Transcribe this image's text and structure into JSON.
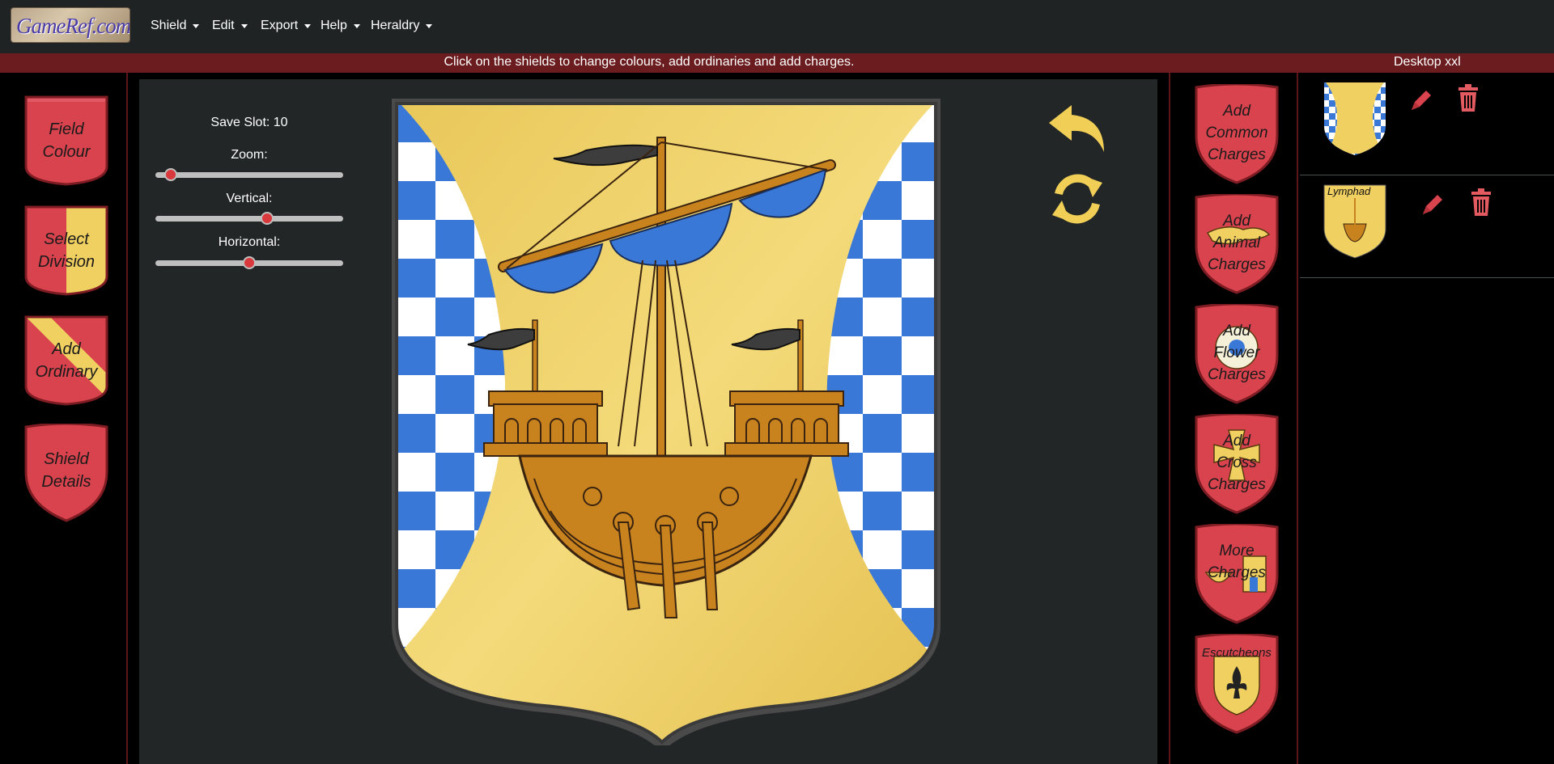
{
  "nav": {
    "logo_text": "GameRef.com",
    "menus": [
      "Shield",
      "Edit",
      "Export",
      "Help",
      "Heraldry"
    ]
  },
  "banner": {
    "message": "Click on the shields to change colours, add ordinaries and add charges.",
    "screen_size": "Desktop xxl"
  },
  "left_tools": [
    "Field Colour",
    "Select Division",
    "Add Ordinary",
    "Shield Details"
  ],
  "controls": {
    "save_slot": "Save Slot: 10",
    "zoom_label": "Zoom:",
    "zoom_value": 0.05,
    "vertical_label": "Vertical:",
    "vertical_value": 0.6,
    "horizontal_label": "Horizontal:",
    "horizontal_value": 0.5
  },
  "charge_categories": [
    "Add Common Charges",
    "Add Animal Charges",
    "Add Flower Charges",
    "Add Cross Charges",
    "More Charges",
    "Escutcheons"
  ],
  "layers": [
    {
      "name": "",
      "type": "field"
    },
    {
      "name": "Lymphad",
      "type": "charge"
    }
  ],
  "colors": {
    "or": "#f0d060",
    "azure": "#3a78d8",
    "argent": "#ffffff",
    "gules": "#d9434d",
    "banner": "#6b1c1e",
    "panel": "#222627"
  },
  "icons": {
    "undo": "undo-arrow-icon",
    "refresh": "refresh-icon",
    "edit": "pencil-icon",
    "delete": "trash-icon"
  }
}
